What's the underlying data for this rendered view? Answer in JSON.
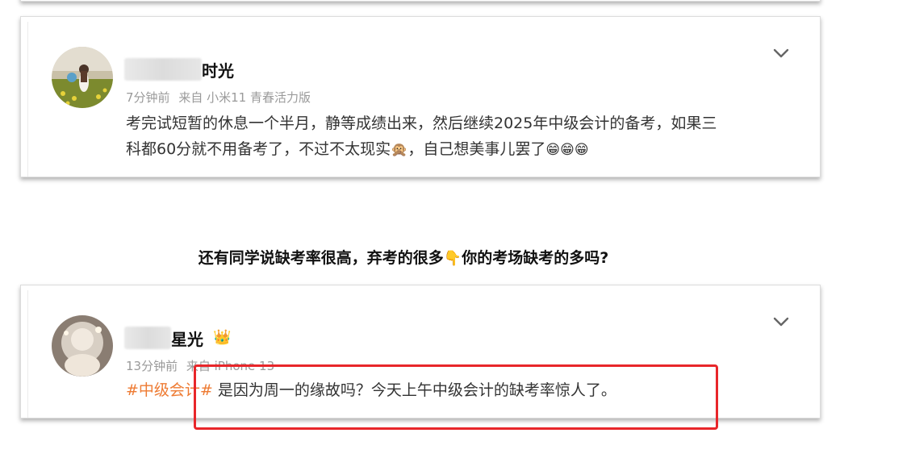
{
  "post1": {
    "name_suffix": "时光",
    "meta_time": "7分钟前",
    "meta_source": "来自 小米11 青春活力版",
    "content_line1": "考完试短暂的休息一个半月，静等成绩出来，然后继续2025年中级会计的备考，如果三",
    "content_line2_a": "科都60分就不用备考了，不过不太现实",
    "emoji_monkey": "🙊",
    "content_line2_b": "，自己想美事儿罢了",
    "emoji_grin": "😁😁😁"
  },
  "heading": {
    "text_a": "还有同学说缺考率很高，弃考的很多",
    "pointer": "👇",
    "text_b": "你的考场缺考的多吗?"
  },
  "post2": {
    "name_suffix": "星光",
    "crown": "👑",
    "meta_time": "13分钟前",
    "meta_source": "来自 iPhone 13",
    "topic": "#中级会计#",
    "content": " 是因为周一的缘故吗？今天上午中级会计的缺考率惊人了。"
  },
  "colors": {
    "topic": "#ee7b33",
    "highlight_box": "#e8262a",
    "meta": "#9a9a9a"
  },
  "icons": [
    "chevron-down-icon",
    "crown-icon",
    "avatar-photo"
  ]
}
